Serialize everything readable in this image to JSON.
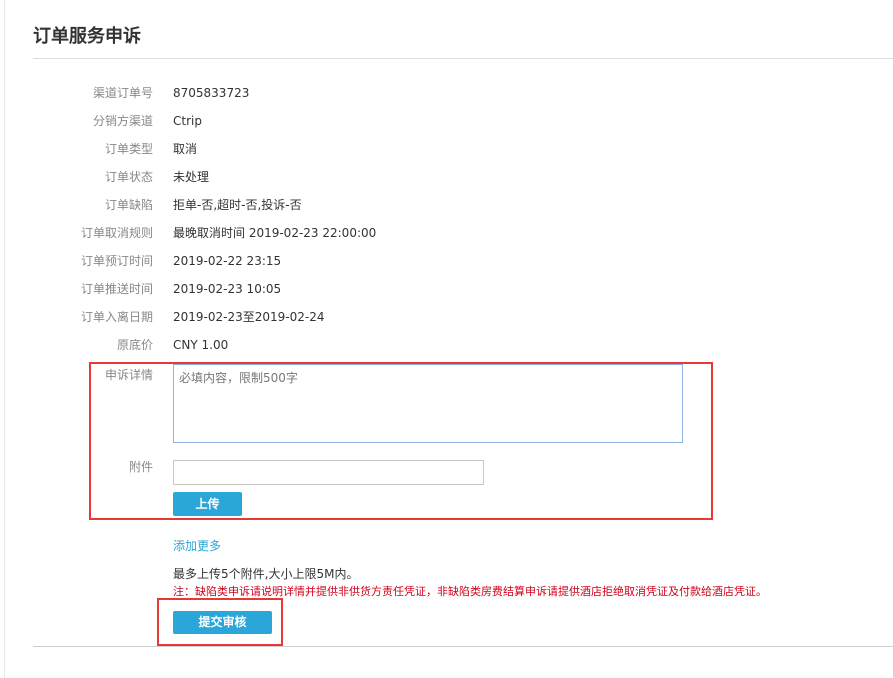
{
  "page": {
    "title": "订单服务申诉"
  },
  "fields": [
    {
      "label": "渠道订单号",
      "value": "8705833723"
    },
    {
      "label": "分销方渠道",
      "value": "Ctrip"
    },
    {
      "label": "订单类型",
      "value": "取消"
    },
    {
      "label": "订单状态",
      "value": "未处理"
    },
    {
      "label": "订单缺陷",
      "value": "拒单-否,超时-否,投诉-否"
    },
    {
      "label": "订单取消规则",
      "value": "最晚取消时间 2019-02-23 22:00:00"
    },
    {
      "label": "订单预订时间",
      "value": "2019-02-22 23:15"
    },
    {
      "label": "订单推送时间",
      "value": "2019-02-23 10:05"
    },
    {
      "label": "订单入离日期",
      "value": "2019-02-23至2019-02-24"
    },
    {
      "label": "原底价",
      "value": "CNY 1.00"
    }
  ],
  "appeal": {
    "detail_label": "申诉详情",
    "detail_placeholder": "必填内容，限制500字",
    "attachment_label": "附件",
    "upload_label": "上传",
    "add_more": "添加更多",
    "limit_text": "最多上传5个附件,大小上限5M内。",
    "note": "注：缺陷类申诉请说明详情并提供非供货方责任凭证，非缺陷类房费结算申诉请提供酒店拒绝取消凭证及付款给酒店凭证。",
    "submit_label": "提交审核"
  },
  "colors": {
    "accent": "#2aa6d8",
    "highlight": "#e53935",
    "note": "#d0021b"
  }
}
